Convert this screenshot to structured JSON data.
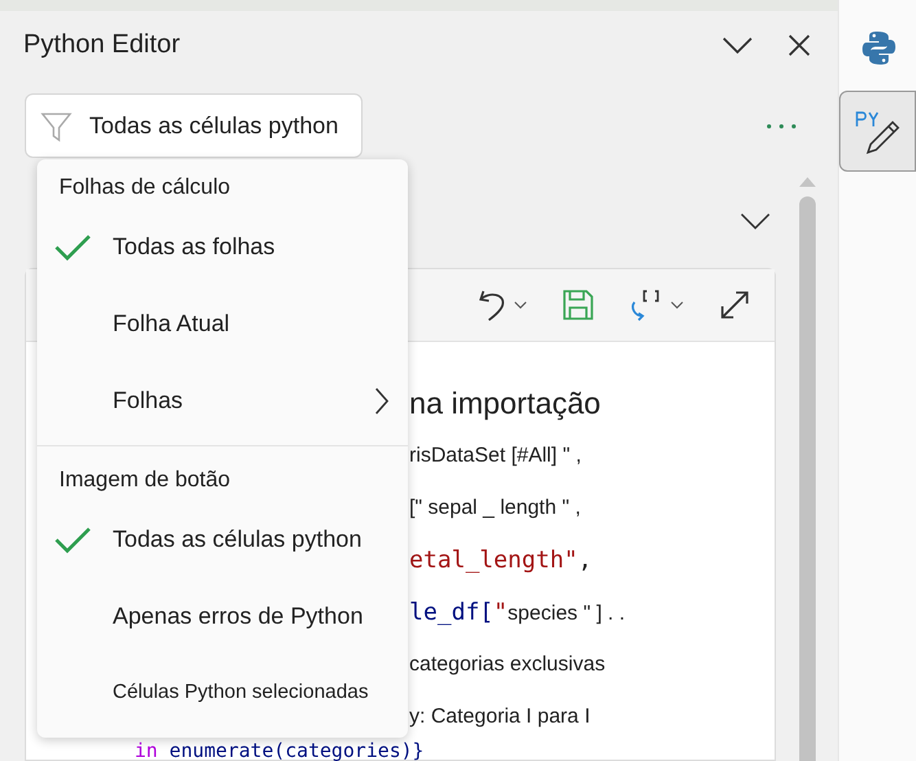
{
  "panel": {
    "title": "Python Editor"
  },
  "filter": {
    "value": "Todas as células python"
  },
  "menu": {
    "sections": [
      {
        "heading": "Folhas de cálculo",
        "items": [
          {
            "label": "Todas as folhas",
            "checked": true,
            "submenu": false,
            "kind": "normal"
          },
          {
            "label": "Folha Atual",
            "checked": false,
            "submenu": false,
            "kind": "normal"
          },
          {
            "label": "Folhas",
            "checked": false,
            "submenu": true,
            "kind": "normal"
          }
        ]
      },
      {
        "heading": "Imagem de botão",
        "items": [
          {
            "label": "Todas as células python",
            "checked": true,
            "submenu": false,
            "kind": "normal"
          },
          {
            "label": "Apenas erros de Python",
            "checked": false,
            "submenu": false,
            "kind": "normal"
          },
          {
            "label": "Células Python selecionadas",
            "checked": false,
            "submenu": false,
            "kind": "compact"
          }
        ]
      }
    ]
  },
  "code_lines": [
    {
      "kind": "heading",
      "segments": [
        {
          "kind": "text",
          "text": "na importação"
        }
      ]
    },
    {
      "kind": "line",
      "segments": [
        {
          "kind": "text",
          "text": "risDataSet [#All] \" ,"
        }
      ]
    },
    {
      "kind": "line",
      "segments": [
        {
          "kind": "text",
          "text": "[\" sepal _ length \" ,"
        }
      ]
    },
    {
      "kind": "line",
      "segments": [
        {
          "kind": "string",
          "text": "etal_length\""
        },
        {
          "kind": "punct",
          "text": ","
        }
      ]
    },
    {
      "kind": "line",
      "segments": [
        {
          "kind": "code",
          "text": "le_df["
        },
        {
          "kind": "string",
          "text": "\""
        },
        {
          "kind": "text",
          "text": "species \" ] . ."
        }
      ]
    },
    {
      "kind": "line",
      "segments": [
        {
          "kind": "text",
          "text": "categorias exclusivas"
        }
      ]
    },
    {
      "kind": "line",
      "segments": [
        {
          "kind": "text",
          "text": "y: Categoria I para I"
        }
      ]
    },
    {
      "kind": "tail",
      "segments": [
        {
          "kind": "keyword",
          "text": "in "
        },
        {
          "kind": "code",
          "text": "enumerate(categories)}"
        }
      ]
    }
  ]
}
